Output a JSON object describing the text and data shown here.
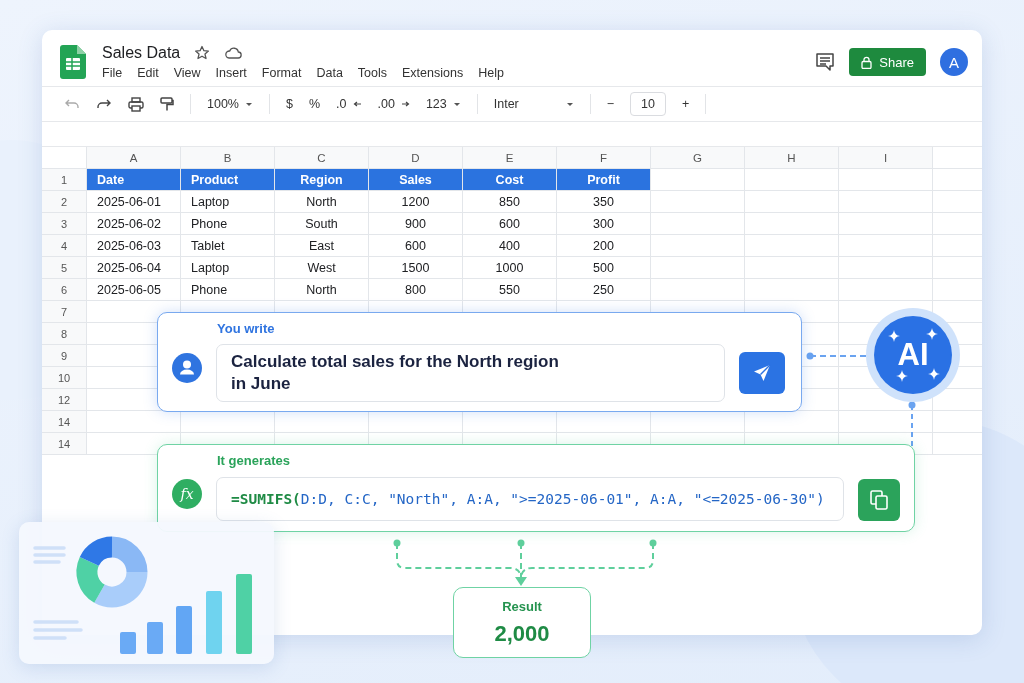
{
  "window": {
    "title": "Sales Data"
  },
  "menu": [
    "File",
    "Edit",
    "View",
    "Insert",
    "Format",
    "Data",
    "Tools",
    "Extensions",
    "Help"
  ],
  "share_button": {
    "label": "Share"
  },
  "avatar": {
    "initial": "A"
  },
  "toolbar": {
    "zoom": "100%",
    "currency": "$",
    "percent": "%",
    "decrease_decimals": ".0",
    "increase_decimals": ".00",
    "number_format": "123",
    "font": "Inter",
    "size_minus": "−",
    "font_size": "10",
    "size_plus": "+"
  },
  "sheet": {
    "columns": [
      "A",
      "B",
      "C",
      "D",
      "E",
      "F",
      "G",
      "H",
      "I"
    ],
    "row_numbers": [
      "1",
      "2",
      "3",
      "4",
      "5",
      "6",
      "7",
      "8",
      "9",
      "10",
      "12",
      "14",
      "14"
    ],
    "header": [
      "Date",
      "Product",
      "Region",
      "Sales",
      "Cost",
      "Profit"
    ],
    "rows": [
      [
        "2025-06-01",
        "Laptop",
        "North",
        "1200",
        "850",
        "350"
      ],
      [
        "2025-06-02",
        "Phone",
        "South",
        "900",
        "600",
        "300"
      ],
      [
        "2025-06-03",
        "Tablet",
        "East",
        "600",
        "400",
        "200"
      ],
      [
        "2025-06-04",
        "Laptop",
        "West",
        "1500",
        "1000",
        "500"
      ],
      [
        "2025-06-05",
        "Phone",
        "North",
        "800",
        "550",
        "250"
      ]
    ]
  },
  "prompt_card": {
    "label": "You write",
    "text": "Calculate total sales for the North region in June"
  },
  "ai_badge": {
    "label": "AI"
  },
  "formula_card": {
    "label": "It generates",
    "icon_text": "fx",
    "function": "=SUMIFS(",
    "arguments": "D:D, C:C, \"North\", A:A, \">=2025-06-01\", A:A, \"<=2025-06-30\")"
  },
  "result": {
    "label": "Result",
    "value": "2,000"
  }
}
